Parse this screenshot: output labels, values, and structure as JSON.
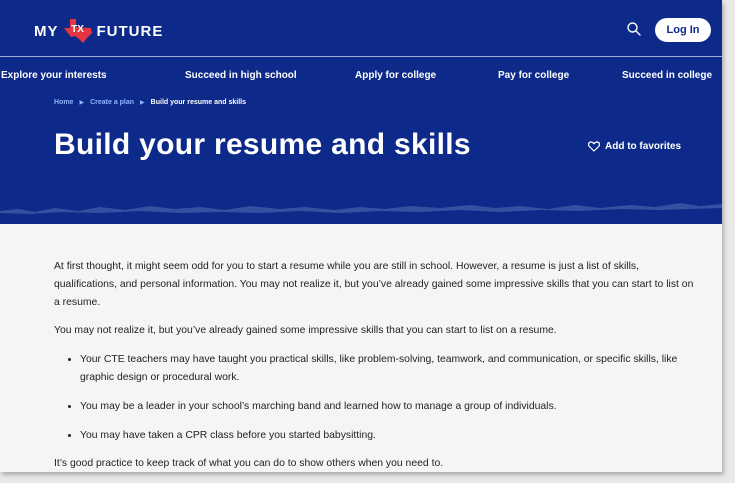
{
  "header": {
    "logo": {
      "left": "MY",
      "mark": "TX",
      "right": "FUTURE"
    },
    "login_label": "Log In"
  },
  "nav": {
    "items": [
      {
        "label": "Explore your interests"
      },
      {
        "label": "Succeed in high school"
      },
      {
        "label": "Apply for college"
      },
      {
        "label": "Pay for college"
      },
      {
        "label": "Succeed in college"
      }
    ]
  },
  "breadcrumb": {
    "items": [
      "Home",
      "Create a plan",
      "Build your resume and skills"
    ]
  },
  "hero": {
    "title": "Build your resume and skills",
    "favorite_label": "Add to favorites"
  },
  "article": {
    "paragraphs": [
      "At first thought, it might seem odd for you to start a resume while you are still in school. However, a resume is just a list of skills, qualifications, and personal information. You may not realize it, but you’ve already gained some impressive skills that you can start to list on a resume.",
      "You may not realize it, but you’ve already gained some impressive skills that you can start to list on a resume."
    ],
    "bullets": [
      "Your CTE teachers may have taught you practical skills, like problem-solving, teamwork, and communication, or specific skills, like graphic design or procedural work.",
      "You may be a leader in your school’s marching band and learned how to manage a group of individuals.",
      "You may have taken a CPR class before you started babysitting."
    ],
    "closing": "It’s good practice to keep track of what you can do to show others when you need to."
  },
  "colors": {
    "brand_blue": "#0d2a8a",
    "brand_red": "#e3343f",
    "breadcrumb_link": "#8fb2ff"
  },
  "icons": {
    "search": "search-icon",
    "favorite": "heart-outline-icon",
    "logo_shape": "texas-shape-icon"
  }
}
